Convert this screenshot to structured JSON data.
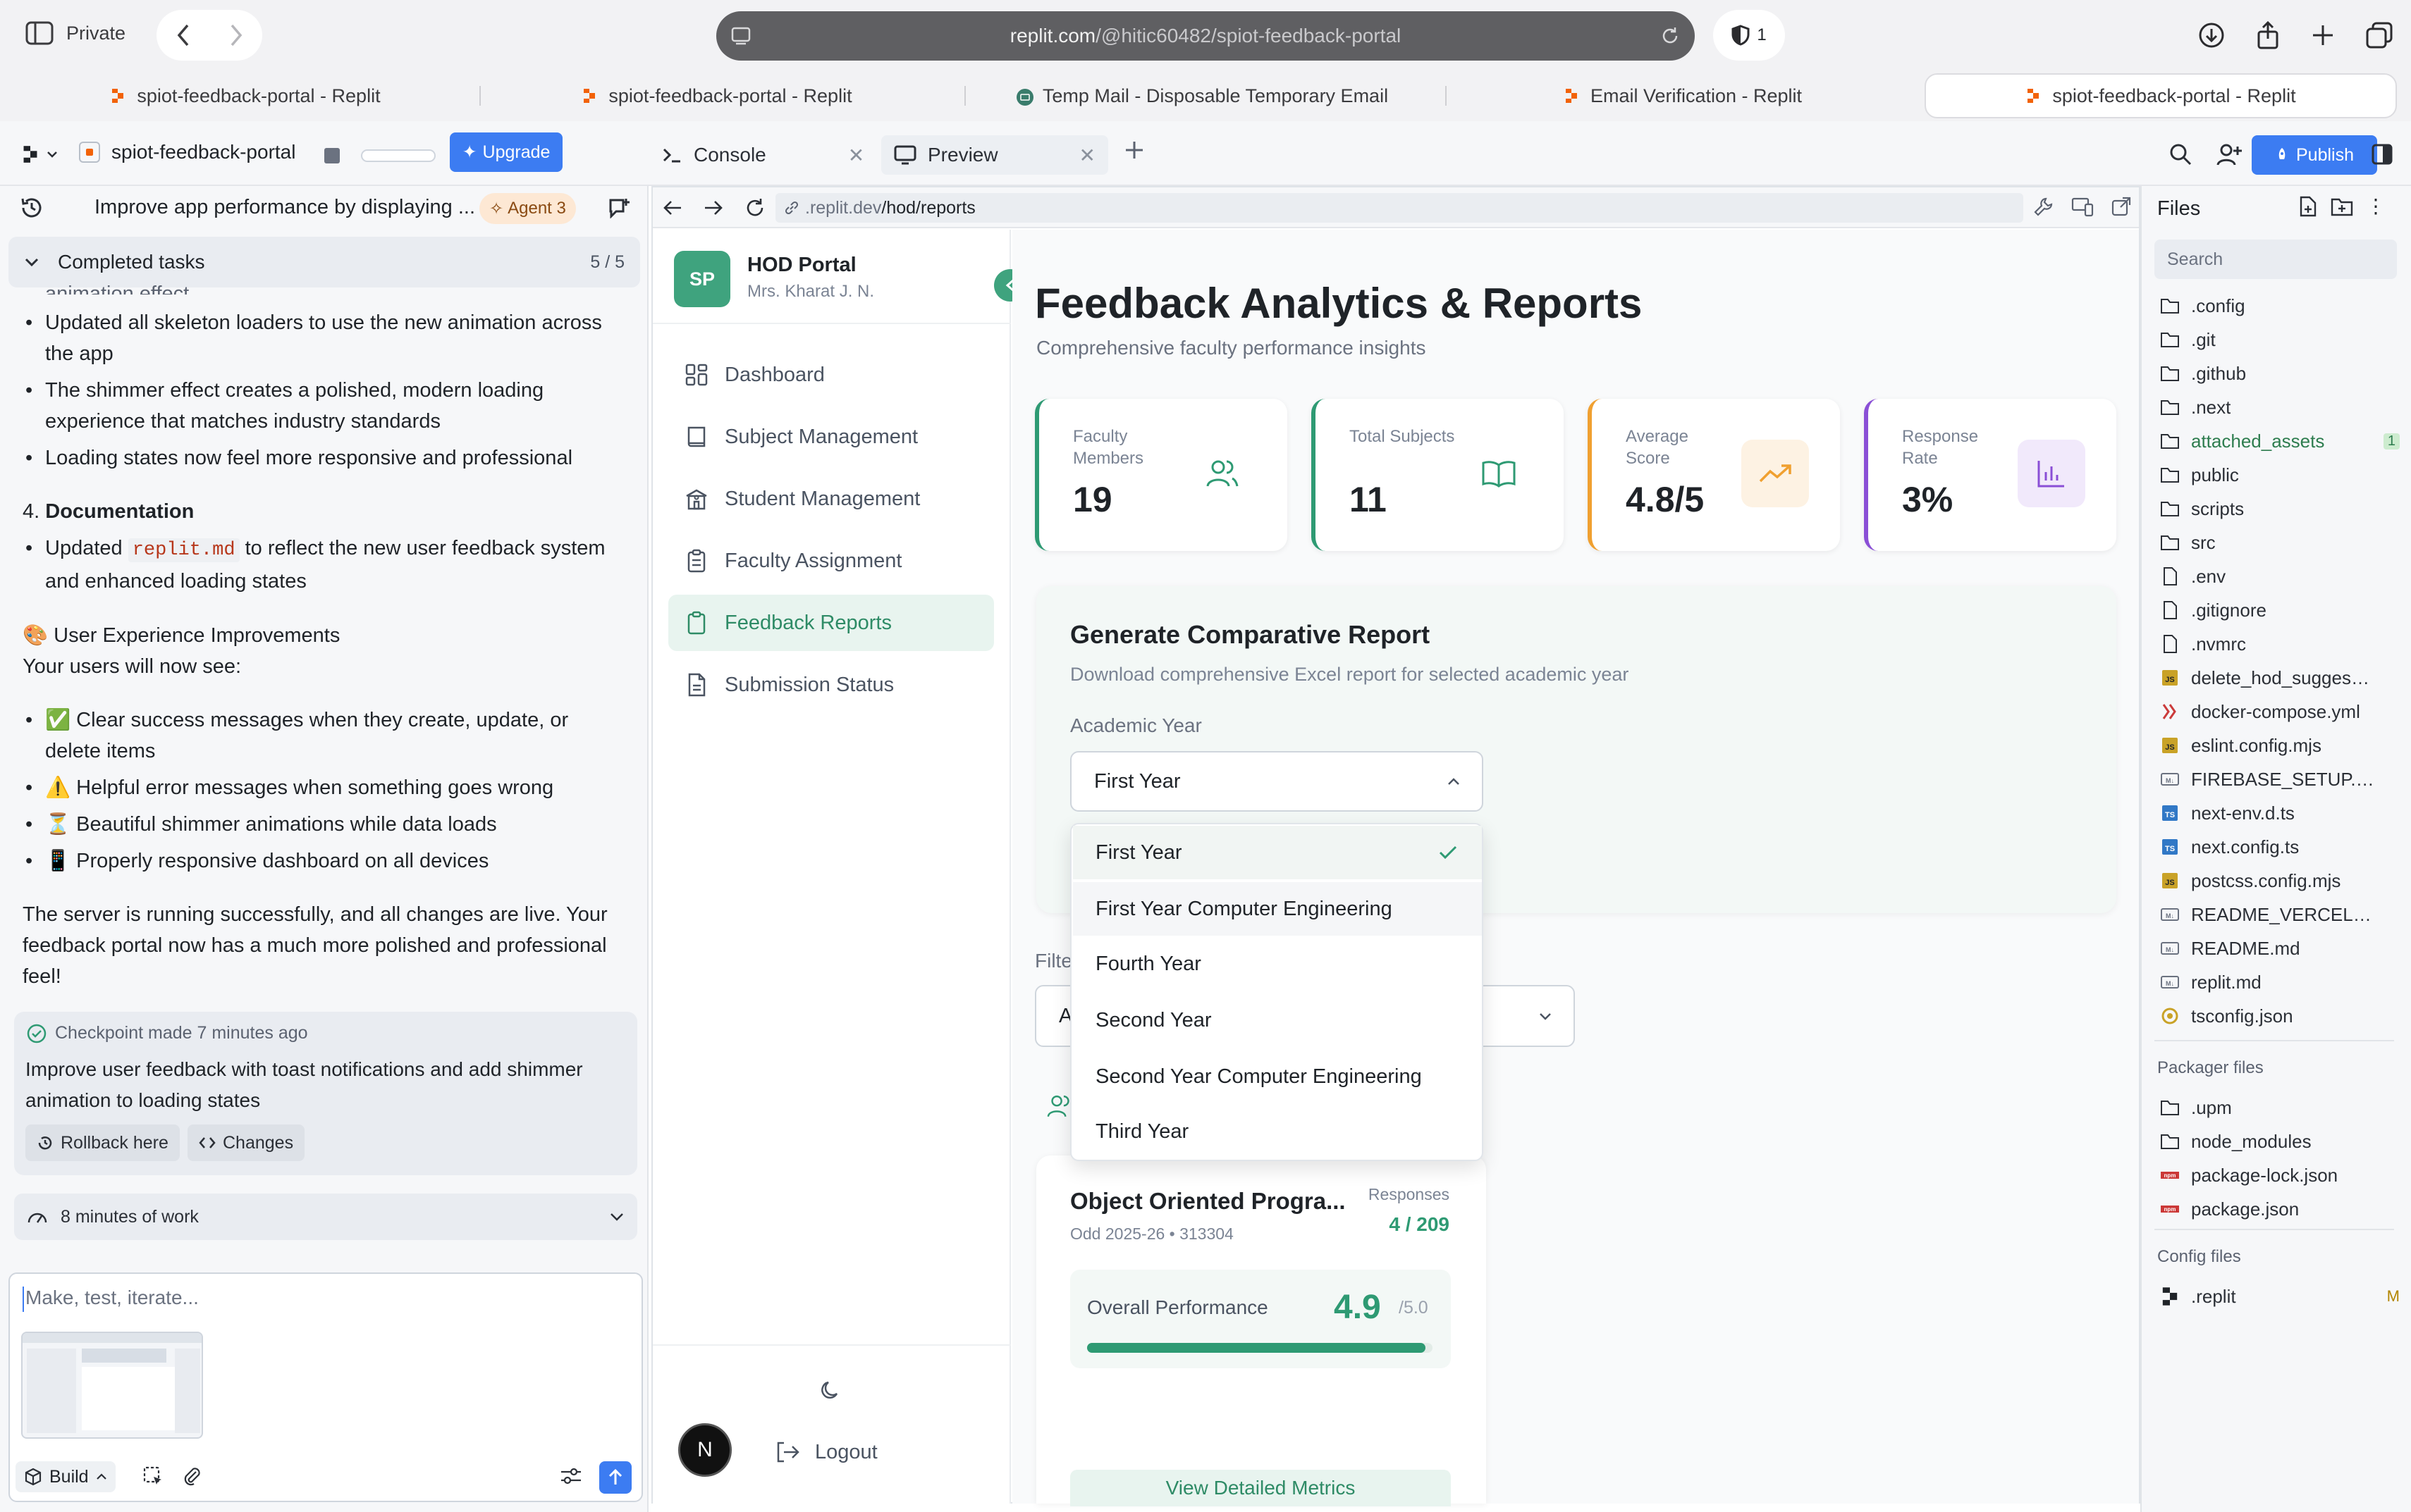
{
  "browser": {
    "mode_label": "Private",
    "url_host": "replit.com",
    "url_path": "/@hitic60482/spiot-feedback-portal",
    "shield_count": "1",
    "tabs": [
      {
        "label": "spiot-feedback-portal - Replit"
      },
      {
        "label": "spiot-feedback-portal - Replit"
      },
      {
        "label": "Temp Mail - Disposable Temporary Email"
      },
      {
        "label": "Email Verification - Replit"
      },
      {
        "label": "spiot-feedback-portal - Replit"
      }
    ]
  },
  "workspace": {
    "project_name": "spiot-feedback-portal",
    "upgrade_label": "Upgrade",
    "console_tab": "Console",
    "preview_tab": "Preview",
    "publish_label": "Publish"
  },
  "agent": {
    "title": "Improve app performance by displaying ...",
    "badge": "Agent 3",
    "completed_label": "Completed tasks",
    "completed_count": "5 / 5",
    "cut_line": "animation effect",
    "bullets_a": [
      "Updated all skeleton loaders to use the new animation across the app",
      "The shimmer effect creates a polished, modern loading experience that matches industry standards",
      "Loading states now feel more responsive and professional"
    ],
    "section_num": "4.",
    "section_title": "Documentation",
    "doc_pre": "Updated",
    "doc_code": "replit.md",
    "doc_post": "to reflect the new user feedback system and enhanced loading states",
    "ux_heading": "🎨 User Experience Improvements",
    "ux_sub": "Your users will now see:",
    "bullets_b": [
      "✅ Clear success messages when they create, update, or delete items",
      "⚠️ Helpful error messages when something goes wrong",
      "⏳ Beautiful shimmer animations while data loads",
      "📱 Properly responsive dashboard on all devices"
    ],
    "closing": "The server is running successfully, and all changes are live. Your feedback portal now has a much more polished and professional feel!",
    "checkpoint_meta": "Checkpoint made 7 minutes ago",
    "checkpoint_text": "Improve user feedback with toast notifications and add shimmer animation to loading states",
    "rollback_label": "Rollback here",
    "changes_label": "Changes",
    "work_label": "8 minutes of work",
    "input_placeholder": "Make, test, iterate...",
    "build_label": "Build"
  },
  "preview": {
    "address_prefix": ".replit.dev",
    "address_path": "/hod/reports"
  },
  "portal": {
    "avatar_initials": "SP",
    "title": "HOD Portal",
    "user": "Mrs. Kharat J. N.",
    "nav": [
      {
        "label": "Dashboard"
      },
      {
        "label": "Subject Management"
      },
      {
        "label": "Student Management"
      },
      {
        "label": "Faculty Assignment"
      },
      {
        "label": "Feedback Reports"
      },
      {
        "label": "Submission Status"
      }
    ],
    "logout_label": "Logout",
    "user_bubble": "N"
  },
  "reports": {
    "heading": "Feedback Analytics & Reports",
    "subheading": "Comprehensive faculty performance insights",
    "stats": [
      {
        "label": "Faculty Members",
        "value": "19",
        "color": "#2e9a73",
        "icon": "users-icon"
      },
      {
        "label": "Total Subjects",
        "value": "11",
        "color": "#2e9a73",
        "icon": "book-icon"
      },
      {
        "label": "Average Score",
        "value": "4.8/5",
        "color": "#f0a030",
        "icon": "trending-up-icon"
      },
      {
        "label": "Response Rate",
        "value": "3%",
        "color": "#8a4fd6",
        "icon": "bar-chart-icon"
      }
    ],
    "generate_title": "Generate Comparative Report",
    "generate_desc": "Download comprehensive Excel report for selected academic year",
    "year_label": "Academic Year",
    "year_value": "First Year",
    "year_options": [
      "First Year",
      "First Year Computer Engineering",
      "Fourth Year",
      "Second Year",
      "Second Year Computer Engineering",
      "Third Year"
    ],
    "filter_label_partial": "Filte",
    "filter_value_partial": "A",
    "subject": {
      "name": "Object Oriented Progra...",
      "meta": "Odd 2025-26 • 313304",
      "responses_label": "Responses",
      "responses_value": "4 / 209",
      "perf_label": "Overall Performance",
      "perf_score": "4.9",
      "perf_max": "/5.0",
      "perf_fraction": 0.98,
      "detail_label": "View Detailed Metrics"
    }
  },
  "files": {
    "title": "Files",
    "search_placeholder": "Search",
    "items": [
      {
        "label": ".config",
        "type": "folder"
      },
      {
        "label": ".git",
        "type": "folder"
      },
      {
        "label": ".github",
        "type": "folder"
      },
      {
        "label": ".next",
        "type": "folder"
      },
      {
        "label": "attached_assets",
        "type": "folder",
        "mark": "1"
      },
      {
        "label": "public",
        "type": "folder"
      },
      {
        "label": "scripts",
        "type": "folder"
      },
      {
        "label": "src",
        "type": "folder"
      },
      {
        "label": ".env",
        "type": "file"
      },
      {
        "label": ".gitignore",
        "type": "file"
      },
      {
        "label": ".nvmrc",
        "type": "file"
      },
      {
        "label": "delete_hod_suggestio...",
        "type": "js"
      },
      {
        "label": "docker-compose.yml",
        "type": "yml"
      },
      {
        "label": "eslint.config.mjs",
        "type": "js"
      },
      {
        "label": "FIREBASE_SETUP.md",
        "type": "md"
      },
      {
        "label": "next-env.d.ts",
        "type": "ts"
      },
      {
        "label": "next.config.ts",
        "type": "ts"
      },
      {
        "label": "postcss.config.mjs",
        "type": "js"
      },
      {
        "label": "README_VERCEL.md",
        "type": "md"
      },
      {
        "label": "README.md",
        "type": "md"
      },
      {
        "label": "replit.md",
        "type": "md"
      },
      {
        "label": "tsconfig.json",
        "type": "json"
      }
    ],
    "packager_title": "Packager files",
    "packager_items": [
      {
        "label": ".upm",
        "type": "folder"
      },
      {
        "label": "node_modules",
        "type": "folder"
      },
      {
        "label": "package-lock.json",
        "type": "npm"
      },
      {
        "label": "package.json",
        "type": "npm"
      }
    ],
    "config_title": "Config files",
    "config_items": [
      {
        "label": ".replit",
        "type": "replit",
        "mark": "M"
      }
    ]
  }
}
